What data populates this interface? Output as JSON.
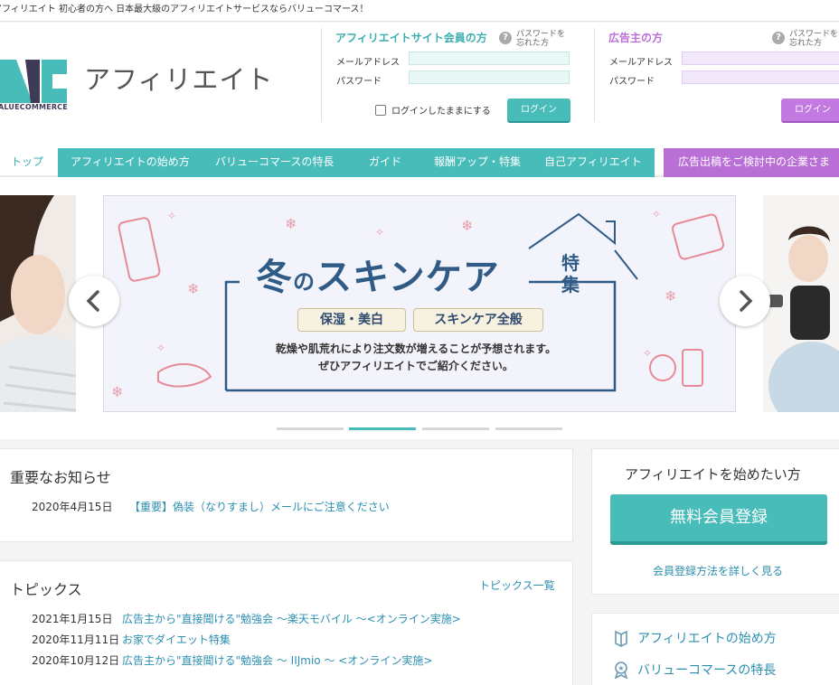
{
  "top_strip": {
    "text": "アフィリエイト 初心者の方へ 日本最大級のアフィリエイトサービスならバリューコマース！"
  },
  "brand": {
    "wordmark": "ALUECOMMERCE",
    "title": "アフィリエイト"
  },
  "affiliate_login": {
    "heading": "アフィリエイトサイト会員の方",
    "forgot": "パスワードを\n忘れた方",
    "email_label": "メールアドレス",
    "password_label": "パスワード",
    "remember_label": "ログインしたままにする",
    "login_button": "ログイン"
  },
  "advertiser_login": {
    "heading": "広告主の方",
    "forgot": "パスワードを\n忘れた方",
    "email_label": "メールアドレス",
    "password_label": "パスワード",
    "login_button": "ログイン"
  },
  "nav": {
    "items": [
      "トップ",
      "アフィリエイトの始め方",
      "バリューコマースの特長",
      "ガイド",
      "報酬アップ・特集",
      "自己アフィリエイト"
    ],
    "advertiser": "広告出稿をご検討中の企業さま"
  },
  "banner": {
    "title_1": "冬",
    "title_2": "の",
    "title_3": "スキンケア",
    "side": "特集",
    "pill_1": "保湿・美白",
    "pill_2": "スキンケア全般",
    "sub_1": "乾燥や肌荒れにより注文数が増えることが予想されます。",
    "sub_2": "ぜひアフィリエイトでご紹介ください。",
    "active_slide": 2,
    "slide_count": 4
  },
  "news": {
    "title": "重要なお知らせ",
    "items": [
      {
        "date": "2020年4月15日",
        "text": "【重要】偽装（なりすまし）メールにご注意ください"
      }
    ]
  },
  "topics": {
    "title": "トピックス",
    "more": "トピックス一覧",
    "items": [
      {
        "date": "2021年1月15日",
        "text": "広告主から\"直接聞ける\"勉強会 〜楽天モバイル 〜<オンライン実施>"
      },
      {
        "date": "2020年11月11日",
        "text": "お家でダイエット特集"
      },
      {
        "date": "2020年10月12日",
        "text": "広告主から\"直接聞ける\"勉強会 〜 IIJmio 〜 <オンライン実施>"
      }
    ]
  },
  "signup": {
    "heading": "アフィリエイトを始めたい方",
    "cta": "無料会員登録",
    "link": "会員登録方法を詳しく見る"
  },
  "side_menu": {
    "items": [
      "アフィリエイトの始め方",
      "バリューコマースの特長"
    ]
  },
  "colors": {
    "teal": "#47bcb9",
    "purple": "#b96fd6",
    "link": "#2b8fb0"
  }
}
